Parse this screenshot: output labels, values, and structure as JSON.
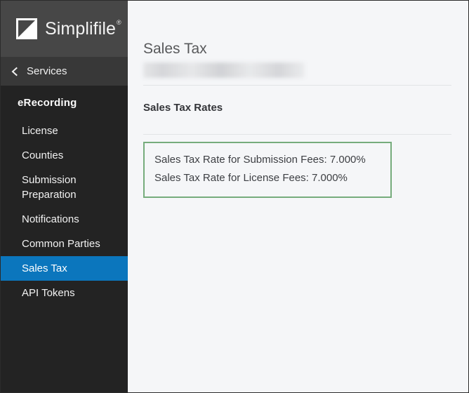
{
  "brand": {
    "name": "Simplifile",
    "registered_mark": "®",
    "logo_icon": "simplifile-triangle-logo"
  },
  "sidebar": {
    "back": {
      "icon": "chevron-left-icon",
      "label": "Services"
    },
    "section_label": "eRecording",
    "items": [
      {
        "label": "License",
        "active": false
      },
      {
        "label": "Counties",
        "active": false
      },
      {
        "label": "Submission Preparation",
        "active": false
      },
      {
        "label": "Notifications",
        "active": false
      },
      {
        "label": "Common Parties",
        "active": false
      },
      {
        "label": "Sales Tax",
        "active": true
      },
      {
        "label": "API Tokens",
        "active": false
      }
    ],
    "active_item": "Sales Tax"
  },
  "main": {
    "page_title": "Sales Tax",
    "account_subtitle_redacted": "",
    "section_title": "Sales Tax Rates",
    "rates": [
      "Sales Tax Rate for Submission Fees: 7.000%",
      "Sales Tax Rate for License Fees: 7.000%"
    ]
  },
  "colors": {
    "sidebar_brand_bg": "#474747",
    "sidebar_services_bg": "#383838",
    "sidebar_bg": "#232323",
    "active_item_bg": "#0b76bd",
    "content_bg": "#f5f6f8",
    "rates_box_border": "#76ac7c",
    "divider": "#e2e4e6",
    "page_title_text": "#58595b"
  }
}
